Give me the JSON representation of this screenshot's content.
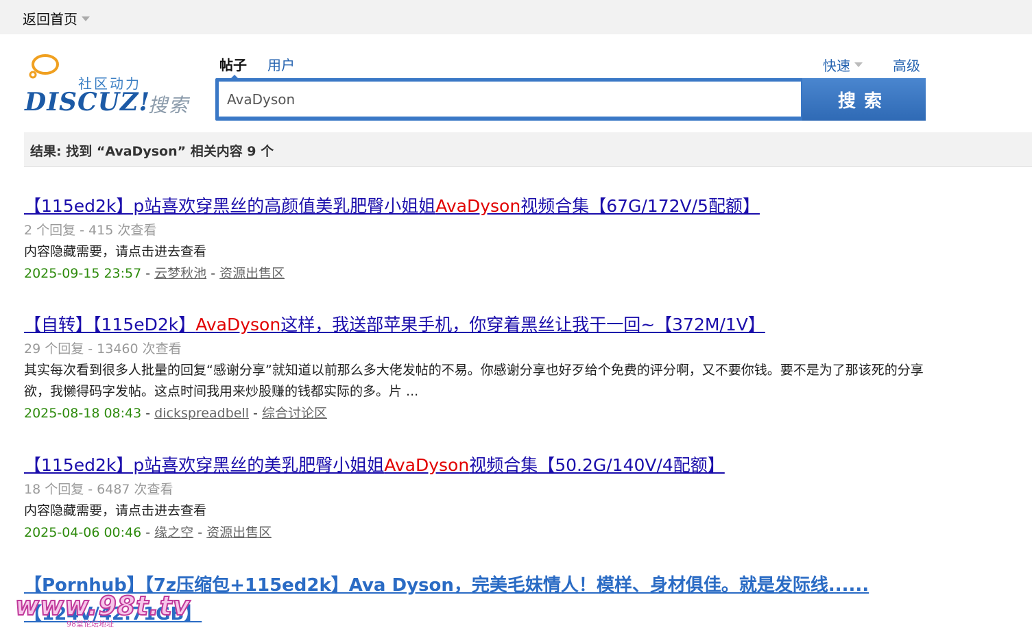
{
  "topbar": {
    "home_label": "返回首页"
  },
  "logo": {
    "slogan": "社区动力",
    "brand": "DISCUZ!",
    "search_word": "搜索"
  },
  "search": {
    "tabs": [
      {
        "label": "帖子"
      },
      {
        "label": "用户"
      }
    ],
    "quick_label": "快速",
    "advanced_label": "高级",
    "query": "AvaDyson",
    "button_label": "搜索"
  },
  "results_header": "结果: 找到 “AvaDyson” 相关内容 9 个",
  "results": [
    {
      "title_pre": "【115ed2k】p站喜欢穿黑丝的高颜值美乳肥臀小姐姐",
      "title_hl": "AvaDyson",
      "title_post": "视频合集【67G/172V/5配额】",
      "meta": "2 个回复 - 415 次查看",
      "summary": "内容隐藏需要，请点击进去查看",
      "date": "2025-09-15 23:57",
      "author": "云梦秋池",
      "forum": "资源出售区"
    },
    {
      "title_pre": "【自转】【115eD2k】",
      "title_hl": "AvaDyson",
      "title_post": "这样，我送部苹果手机，你穿着黑丝让我干一回~【372M/1V】",
      "meta": "29 个回复 - 13460 次查看",
      "summary": "其实每次看到很多人批量的回复“感谢分享”就知道以前那么多大佬发帖的不易。你感谢分享也好歹给个免费的评分啊，又不要你钱。要不是为了那该死的分享欲，我懒得码字发帖。这点时间我用来炒股赚的钱都实际的多。片 ...",
      "date": "2025-08-18 08:43",
      "author": "dickspreadbell",
      "forum": "综合讨论区"
    },
    {
      "title_pre": "【115ed2k】p站喜欢穿黑丝的美乳肥臀小姐姐",
      "title_hl": "AvaDyson",
      "title_post": "视频合集【50.2G/140V/4配额】",
      "meta": "18 个回复 - 6487 次查看",
      "summary": "内容隐藏需要，请点击进去查看",
      "date": "2025-04-06 00:46",
      "author": "缘之空",
      "forum": "资源出售区"
    },
    {
      "title_line1": "【Pornhub】【7z压缩包+115ed2k】Ava Dyson，完美毛妹情人！模样、身材俱佳。就是发际线......",
      "title_line2": "【124V/42.71GB】"
    }
  ],
  "watermark": {
    "text": "www.98t.tv",
    "sub": "98堂论坛地址"
  },
  "colors": {
    "accent": "#3a78c6",
    "link": "#1a0dab",
    "highlight": "#e10000",
    "date": "#2e8b0d"
  }
}
